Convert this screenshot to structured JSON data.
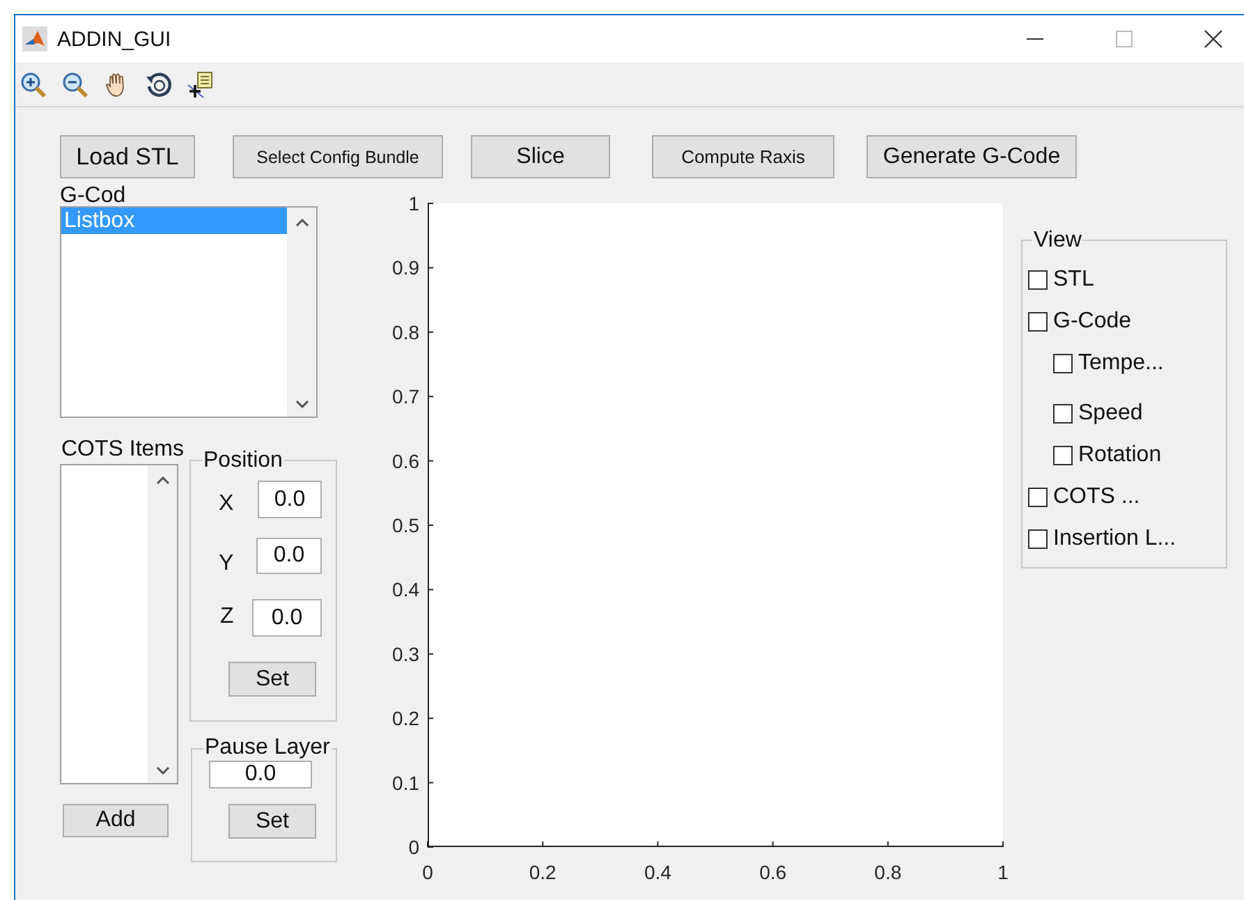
{
  "window": {
    "title": "ADDIN_GUI"
  },
  "buttons": [
    {
      "label": "Load STL"
    },
    {
      "label": "Select Config Bundle"
    },
    {
      "label": "Slice"
    },
    {
      "label": "Compute Raxis"
    },
    {
      "label": "Generate G-Code"
    }
  ],
  "gcode_list": {
    "label": "G-Cod",
    "items": [
      {
        "label": "Listbox",
        "selected": true
      }
    ]
  },
  "cots_list": {
    "label": "COTS Items",
    "add_button": "Add"
  },
  "position": {
    "title": "Position",
    "fields": [
      {
        "label": "X",
        "value": "0.0"
      },
      {
        "label": "Y",
        "value": "0.0"
      },
      {
        "label": "Z",
        "value": "0.0"
      }
    ],
    "set_button": "Set"
  },
  "pause_layer": {
    "title": "Pause Layer",
    "value": "0.0",
    "set_button": "Set"
  },
  "axes": {
    "chart_data": {
      "type": "line",
      "xlim": [
        0,
        1
      ],
      "ylim": [
        0,
        1
      ],
      "xticks": [
        0,
        0.2,
        0.4,
        0.6,
        0.8,
        1
      ],
      "yticks": [
        0,
        0.1,
        0.2,
        0.3,
        0.4,
        0.5,
        0.6,
        0.7,
        0.8,
        0.9,
        1
      ]
    }
  },
  "view": {
    "title": "View",
    "items": [
      {
        "label": "STL",
        "checked": false
      },
      {
        "label": "G-Code",
        "checked": false,
        "children": [
          {
            "label": "Tempe...",
            "checked": false
          },
          {
            "label": "Speed",
            "checked": false
          },
          {
            "label": "Rotation",
            "checked": false
          }
        ]
      },
      {
        "label": "COTS ...",
        "checked": false
      },
      {
        "label": "Insertion L...",
        "checked": false
      }
    ]
  }
}
